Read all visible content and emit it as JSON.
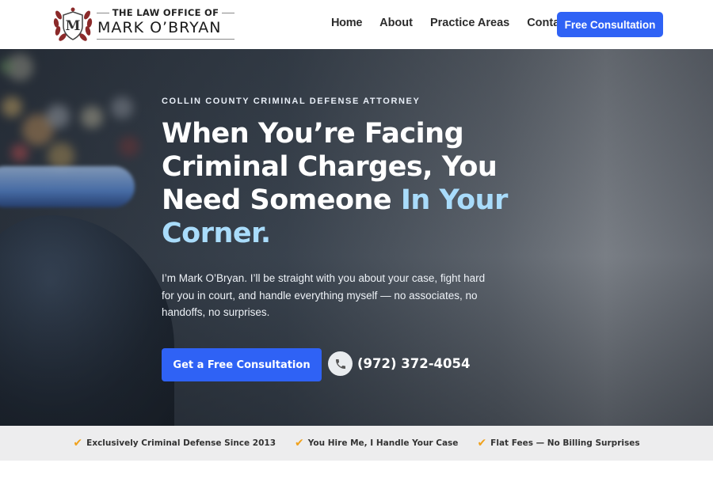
{
  "header": {
    "logo_top": "THE LAW OFFICE OF",
    "logo_name": "MARK O’BRYAN",
    "logo_monogram": "M",
    "nav": [
      {
        "label": "Home"
      },
      {
        "label": "About"
      },
      {
        "label": "Practice Areas"
      },
      {
        "label": "Contact"
      }
    ],
    "cta_label": "Free Consultation"
  },
  "hero": {
    "eyebrow": "COLLIN COUNTY CRIMINAL DEFENSE ATTORNEY",
    "headline_part1": "When You’re Facing Criminal Charges, You Need Someone ",
    "headline_accent": "In Your Corner.",
    "subtext": "I’m Mark O’Bryan. I’ll be straight with you about your case, fight hard for you in court, and handle everything myself — no associates, no handoffs, no surprises.",
    "cta_label": "Get a Free Consultation",
    "phone": "(972) 372-4054",
    "phone_icon": "phone-icon"
  },
  "trust": [
    {
      "label": "Exclusively Criminal Defense Since 2013",
      "icon": "checkmark-icon"
    },
    {
      "label": "You Hire Me, I Handle Your Case",
      "icon": "checkmark-icon"
    },
    {
      "label": "Flat Fees — No Billing Surprises",
      "icon": "checkmark-icon"
    }
  ],
  "colors": {
    "primary": "#2f62f5",
    "accent_text": "#a9dcfb",
    "check": "#f0a11c",
    "crest": "#8b2a2a"
  }
}
